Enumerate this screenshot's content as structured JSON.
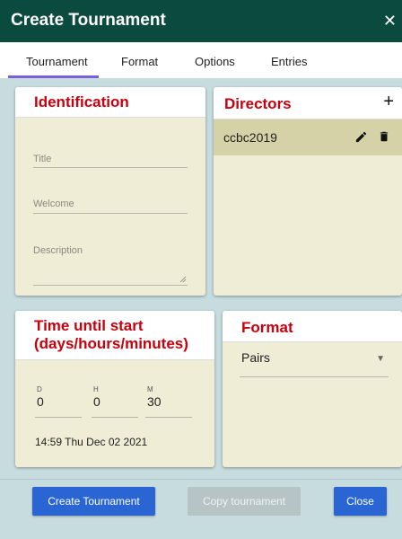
{
  "dialog": {
    "title": "Create Tournament",
    "close_glyph": "✕"
  },
  "tabs": [
    {
      "label": "Tournament",
      "active": true
    },
    {
      "label": "Format"
    },
    {
      "label": "Options"
    },
    {
      "label": "Entries"
    }
  ],
  "identification": {
    "heading": "Identification",
    "fields": {
      "title": {
        "placeholder": "Title",
        "value": ""
      },
      "welcome": {
        "placeholder": "Welcome",
        "value": ""
      },
      "description": {
        "placeholder": "Description",
        "value": ""
      }
    }
  },
  "directors": {
    "heading": "Directors",
    "add_glyph": "+",
    "items": [
      {
        "name": "ccbc2019"
      }
    ]
  },
  "time_until_start": {
    "heading_line1": "Time until start",
    "heading_line2": "(days/hours/minutes)",
    "days": {
      "label": "D",
      "value": "0"
    },
    "hours": {
      "label": "H",
      "value": "0"
    },
    "minutes": {
      "label": "M",
      "value": "30"
    },
    "start_datetime": "14:59 Thu Dec 02 2021"
  },
  "format": {
    "heading": "Format",
    "selected": "Pairs"
  },
  "footer": {
    "create_label": "Create Tournament",
    "copy_label": "Copy tournament",
    "close_label": "Close"
  },
  "colors": {
    "titlebar": "#0b4a3f",
    "heading_red": "#c8000d",
    "card_bg": "#efedd6",
    "director_row": "#d6d2a8",
    "primary_button": "#2a65d4",
    "tab_indicator": "#7b5fd6"
  }
}
